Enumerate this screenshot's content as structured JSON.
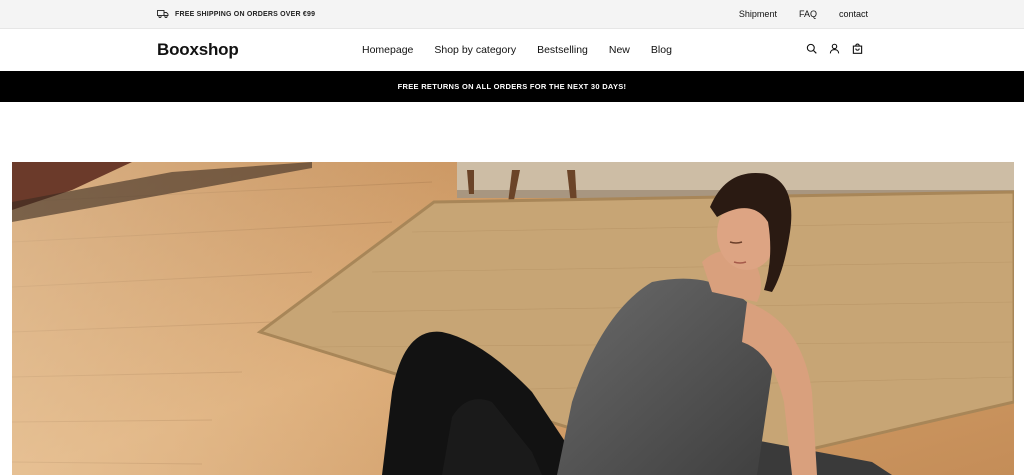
{
  "topbar": {
    "shipping_text": "FREE SHIPPING ON ORDERS OVER €99",
    "links": [
      "Shipment",
      "FAQ",
      "contact"
    ]
  },
  "header": {
    "logo": "Booxshop",
    "nav": [
      "Homepage",
      "Shop by category",
      "Bestselling",
      "New",
      "Blog"
    ],
    "icons": [
      "search-icon",
      "account-icon",
      "cart-icon"
    ]
  },
  "announcement": {
    "text": "FREE RETURNS ON ALL ORDERS FOR THE NEXT 30 DAYS!"
  },
  "colors": {
    "announcement_bg": "#000000",
    "topbar_bg": "#f4f4f4"
  }
}
